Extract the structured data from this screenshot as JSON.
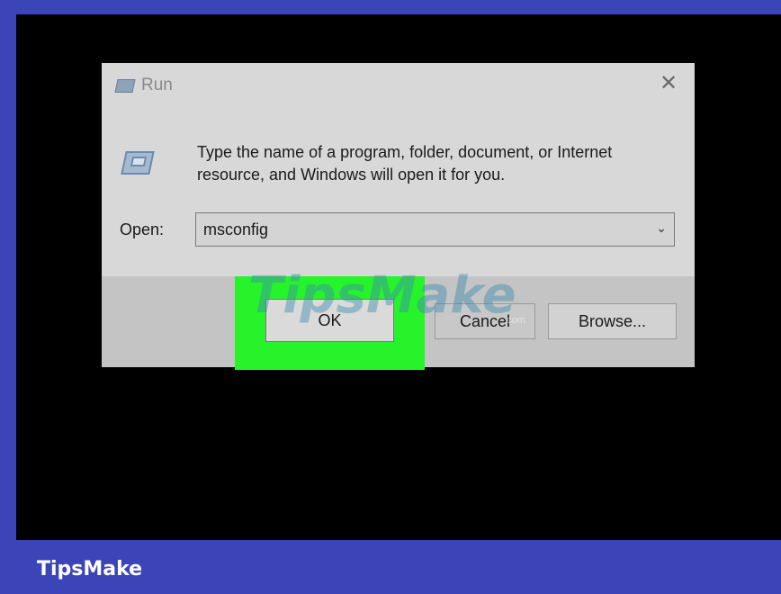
{
  "dialog": {
    "title": "Run",
    "close_glyph": "✕",
    "description": "Type the name of a program, folder, document, or Internet resource, and Windows will open it for you.",
    "open_label": "Open:",
    "open_value": "msconfig",
    "dropdown_glyph": "⌄",
    "buttons": {
      "ok": "OK",
      "cancel": "Cancel",
      "browse": "Browse..."
    }
  },
  "brand": "TipsMake",
  "watermark": "TipsMake",
  "watermark_suffix": ".com",
  "colors": {
    "frame": "#3b45b8",
    "highlight": "#27f32a",
    "dialog_bg": "#d8d8d8"
  },
  "icons": [
    "run-icon",
    "run-program-icon",
    "close-icon",
    "chevron-down-icon"
  ]
}
